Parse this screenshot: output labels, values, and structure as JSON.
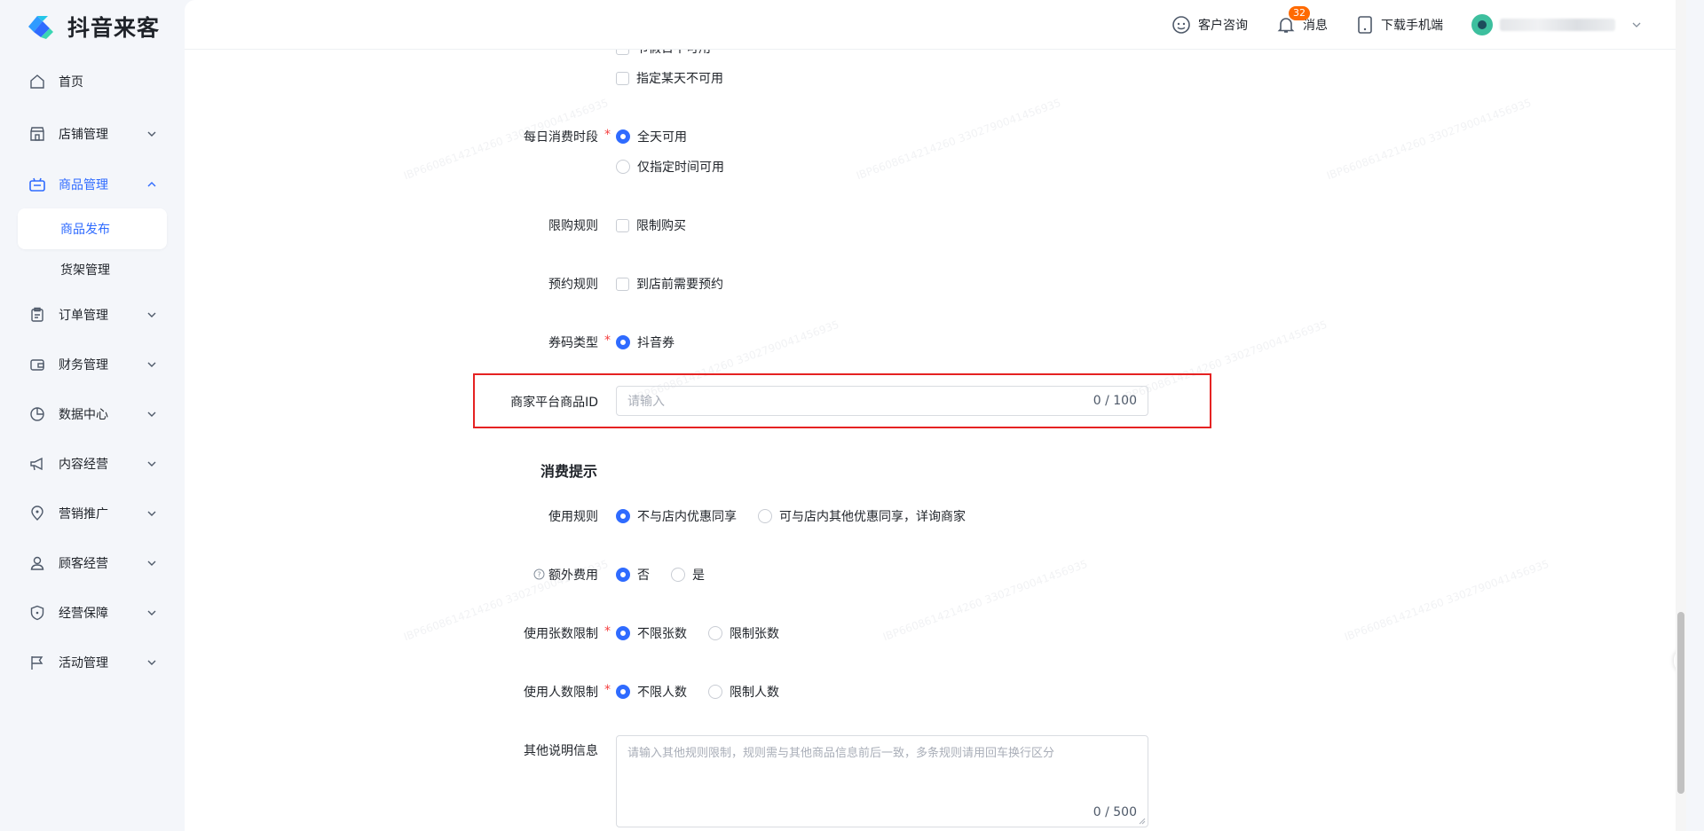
{
  "app": {
    "name": "抖音来客"
  },
  "sidebar": {
    "items": [
      {
        "label": "首页",
        "icon": "home-icon"
      },
      {
        "label": "店铺管理",
        "icon": "store-icon"
      },
      {
        "label": "商品管理",
        "icon": "goods-icon"
      },
      {
        "label": "订单管理",
        "icon": "order-icon"
      },
      {
        "label": "财务管理",
        "icon": "wallet-icon"
      },
      {
        "label": "数据中心",
        "icon": "pie-chart-icon"
      },
      {
        "label": "内容经营",
        "icon": "megaphone-icon"
      },
      {
        "label": "营销推广",
        "icon": "location-pin-icon"
      },
      {
        "label": "顾客经营",
        "icon": "user-icon"
      },
      {
        "label": "经营保障",
        "icon": "shield-icon"
      },
      {
        "label": "活动管理",
        "icon": "flag-icon"
      }
    ],
    "sub_items": [
      {
        "label": "商品发布"
      },
      {
        "label": "货架管理"
      }
    ]
  },
  "topbar": {
    "customer_service": "客户咨询",
    "messages": "消息",
    "message_count": "32",
    "download_app": "下载手机端"
  },
  "form": {
    "partial_top_option": "节假日不可用",
    "specific_day_option": "指定某天不可用",
    "daily_time": {
      "label": "每日消费时段",
      "options": [
        "全天可用",
        "仅指定时间可用"
      ]
    },
    "purchase_limit": {
      "label": "限购规则",
      "option": "限制购买"
    },
    "reservation": {
      "label": "预约规则",
      "option": "到店前需要预约"
    },
    "code_type": {
      "label": "券码类型",
      "option": "抖音券"
    },
    "merchant_id": {
      "label": "商家平台商品ID",
      "placeholder": "请输入",
      "counter": "0 / 100"
    },
    "section_title": "消费提示",
    "usage_rule": {
      "label": "使用规则",
      "options": [
        "不与店内优惠同享",
        "可与店内其他优惠同享，详询商家"
      ]
    },
    "extra_fee": {
      "label": "额外费用",
      "options": [
        "否",
        "是"
      ]
    },
    "ticket_limit": {
      "label": "使用张数限制",
      "options": [
        "不限张数",
        "限制张数"
      ]
    },
    "people_limit": {
      "label": "使用人数限制",
      "options": [
        "不限人数",
        "限制人数"
      ]
    },
    "other_info": {
      "label": "其他说明信息",
      "placeholder": "请输入其他规则限制，规则需与其他商品信息前后一致，多条规则请用回车换行区分",
      "counter": "0 / 500"
    }
  }
}
